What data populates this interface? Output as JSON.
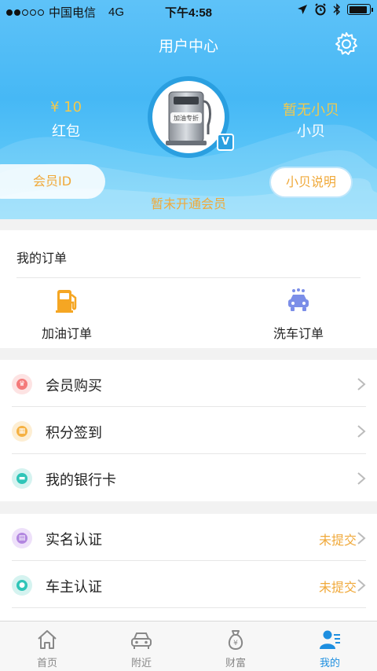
{
  "status_bar": {
    "carrier": "中国电信",
    "network": "4G",
    "time": "下午4:58",
    "battery_level": 0.9
  },
  "header": {
    "title": "用户中心",
    "settings_icon": "gear-icon"
  },
  "account": {
    "redpacket_amount": "¥ 10",
    "redpacket_label": "红包",
    "beibei_amount": "暂无小贝",
    "beibei_label": "小贝",
    "avatar_text": "加油专折",
    "vip_badge": "V",
    "member_id_label": "会员ID",
    "member_status": "暂未开通会员",
    "beibei_help_button": "小贝说明"
  },
  "orders": {
    "title": "我的订单",
    "items": [
      {
        "label": "加油订单",
        "icon": "fuel-pump-icon"
      },
      {
        "label": "洗车订单",
        "icon": "car-wash-icon"
      }
    ]
  },
  "menu_primary": [
    {
      "label": "会员购买",
      "icon": "crown-icon",
      "color": "#f47a7a"
    },
    {
      "label": "积分签到",
      "icon": "calendar-icon",
      "color": "#f5b142"
    },
    {
      "label": "我的银行卡",
      "icon": "bank-card-icon",
      "color": "#2fc5b8"
    }
  ],
  "menu_secondary": [
    {
      "label": "实名认证",
      "icon": "id-card-icon",
      "color": "#b286e0",
      "status": "未提交"
    },
    {
      "label": "车主认证",
      "icon": "car-owner-icon",
      "color": "#2fc5b8",
      "status": "未提交"
    }
  ],
  "tabbar": {
    "items": [
      {
        "label": "首页",
        "icon": "home-icon",
        "active": false
      },
      {
        "label": "附近",
        "icon": "car-icon",
        "active": false
      },
      {
        "label": "财富",
        "icon": "money-bag-icon",
        "active": false
      },
      {
        "label": "我的",
        "icon": "user-icon",
        "active": true
      }
    ],
    "active_color": "#1e8fe0"
  },
  "colors": {
    "accent": "#f0a93a",
    "header_blue": "#46b8f5"
  }
}
